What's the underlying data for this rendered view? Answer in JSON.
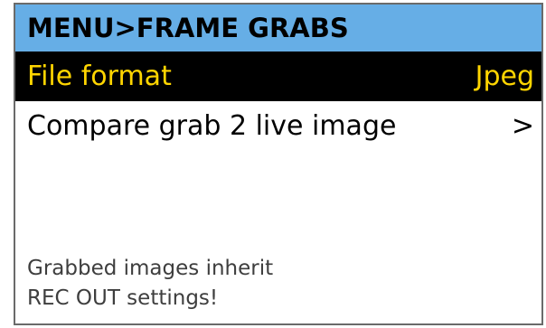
{
  "header": {
    "title": "MENU>FRAME GRABS"
  },
  "menu": {
    "items": [
      {
        "label": "File format",
        "value": "Jpeg",
        "selected": true
      },
      {
        "label": "Compare grab 2 live image",
        "value": ">",
        "selected": false
      }
    ]
  },
  "footer": {
    "note_line_1": "Grabbed images inherit",
    "note_line_2": "REC OUT settings!"
  },
  "colors": {
    "title_bar": "#66aee6",
    "selected_bg": "#000000",
    "selected_text": "#ffd500",
    "normal_text": "#000000",
    "note_text": "#3e3e3e",
    "frame_border": "#6a6a6a"
  }
}
